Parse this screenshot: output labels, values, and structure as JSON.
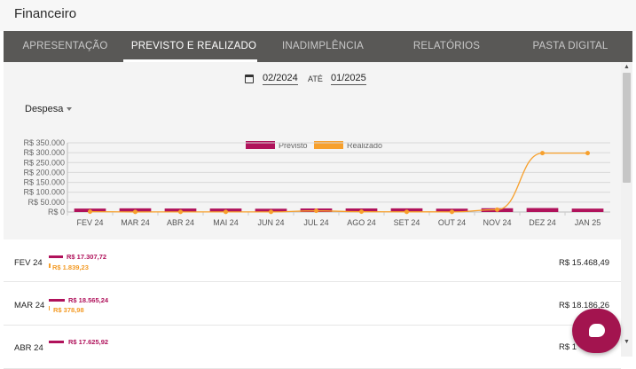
{
  "app": {
    "title": "Financeiro"
  },
  "tabs": [
    {
      "label": "APRESENTAÇÃO"
    },
    {
      "label": "PREVISTO E REALIZADO"
    },
    {
      "label": "INADIMPLÊNCIA"
    },
    {
      "label": "RELATÓRIOS"
    },
    {
      "label": "PASTA DIGITAL"
    }
  ],
  "active_tab": "PREVISTO E REALIZADO",
  "filters": {
    "date_from": "02/2024",
    "date_to": "01/2025",
    "between_label": "ATÉ",
    "type": "Despesa"
  },
  "colors": {
    "previsto": "#b0125b",
    "realizado": "#f7a02c",
    "tabs_bg": "#595856"
  },
  "chart_data": {
    "type": "bar",
    "categories": [
      "FEV 24",
      "MAR 24",
      "ABR 24",
      "MAI 24",
      "JUN 24",
      "JUL 24",
      "AGO 24",
      "SET 24",
      "OUT 24",
      "NOV 24",
      "DEZ 24",
      "JAN 25"
    ],
    "series": [
      {
        "name": "Previsto",
        "type": "bar",
        "color": "#b0125b",
        "values": [
          17307.72,
          18565.24,
          17625.92,
          17500,
          16500,
          17800,
          18000,
          18500,
          16800,
          19000,
          20000,
          17200
        ]
      },
      {
        "name": "Realizado",
        "type": "line",
        "color": "#f7a02c",
        "values": [
          1839.23,
          378.98,
          600,
          500,
          400,
          6000,
          1500,
          800,
          700,
          12000,
          298000,
          298000
        ]
      }
    ],
    "yticks": [
      "R$ 0",
      "R$ 50.000",
      "R$ 100.000",
      "R$ 150.000",
      "R$ 200.000",
      "R$ 250.000",
      "R$ 300.000",
      "R$ 350.000"
    ],
    "ylim": [
      0,
      350000
    ],
    "legend": "top",
    "grid": true
  },
  "rows": [
    {
      "month": "FEV 24",
      "previsto": "R$ 17.307,72",
      "realizado": "R$ 1.839,23",
      "total": "R$ 15.468,49"
    },
    {
      "month": "MAR 24",
      "previsto": "R$ 18.565,24",
      "realizado": "R$ 378,98",
      "total": "R$ 18.186,26"
    },
    {
      "month": "ABR 24",
      "previsto": "R$ 17.625,92",
      "realizado": "",
      "total": "R$ 1"
    }
  ],
  "icons": {
    "calendar": "calendar-icon",
    "chat": "chat-icon",
    "caret": "caret-down-icon"
  }
}
